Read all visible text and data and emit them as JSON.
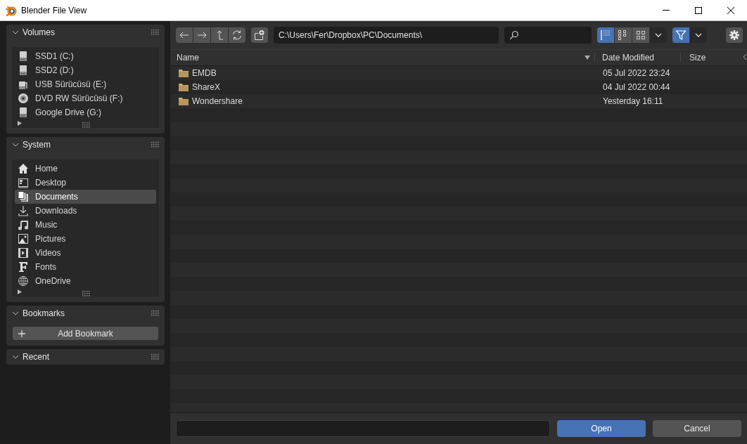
{
  "window": {
    "title": "Blender File View"
  },
  "sidebar": {
    "panels": [
      {
        "title": "Volumes",
        "kind": "places",
        "items": [
          {
            "label": "SSD1 (C:)",
            "kind": "drive",
            "selected": false
          },
          {
            "label": "SSD2 (D:)",
            "kind": "drive",
            "selected": false
          },
          {
            "label": "USB Sürücüsü (E:)",
            "kind": "usb",
            "selected": false
          },
          {
            "label": "DVD RW Sürücüsü (F:)",
            "kind": "disc",
            "selected": false
          },
          {
            "label": "Google Drive (G:)",
            "kind": "drive",
            "selected": false
          }
        ]
      },
      {
        "title": "System",
        "kind": "places",
        "items": [
          {
            "label": "Home",
            "kind": "home",
            "selected": false
          },
          {
            "label": "Desktop",
            "kind": "desktop",
            "selected": false
          },
          {
            "label": "Documents",
            "kind": "documents",
            "selected": true
          },
          {
            "label": "Downloads",
            "kind": "download",
            "selected": false
          },
          {
            "label": "Music",
            "kind": "music",
            "selected": false
          },
          {
            "label": "Pictures",
            "kind": "picture",
            "selected": false
          },
          {
            "label": "Videos",
            "kind": "film",
            "selected": false
          },
          {
            "label": "Fonts",
            "kind": "font",
            "selected": false
          },
          {
            "label": "OneDrive",
            "kind": "globe",
            "selected": false
          }
        ]
      },
      {
        "title": "Bookmarks",
        "kind": "button",
        "button": "Add Bookmark"
      },
      {
        "title": "Recent",
        "kind": "empty"
      }
    ]
  },
  "toolbar": {
    "path": "C:\\Users\\Fer\\Dropbox\\PC\\Documents\\",
    "view_modes": [
      {
        "selected": true
      },
      {
        "selected": false
      },
      {
        "selected": false
      }
    ],
    "filter": {
      "on": true
    }
  },
  "table": {
    "columns": [
      "Name",
      "Date Modified",
      "Size"
    ],
    "rows": [
      {
        "name": "EMDB",
        "date_modified": "05 Jul 2022 23:24"
      },
      {
        "name": "ShareX",
        "date_modified": "04 Jul 2022 00:44"
      },
      {
        "name": "Wondershare",
        "date_modified": "Yesterday 16:11"
      }
    ]
  },
  "footer": {
    "buttons": [
      {
        "label": "Open",
        "kind": "primary"
      },
      {
        "label": "Cancel",
        "kind": "secondary"
      }
    ]
  }
}
